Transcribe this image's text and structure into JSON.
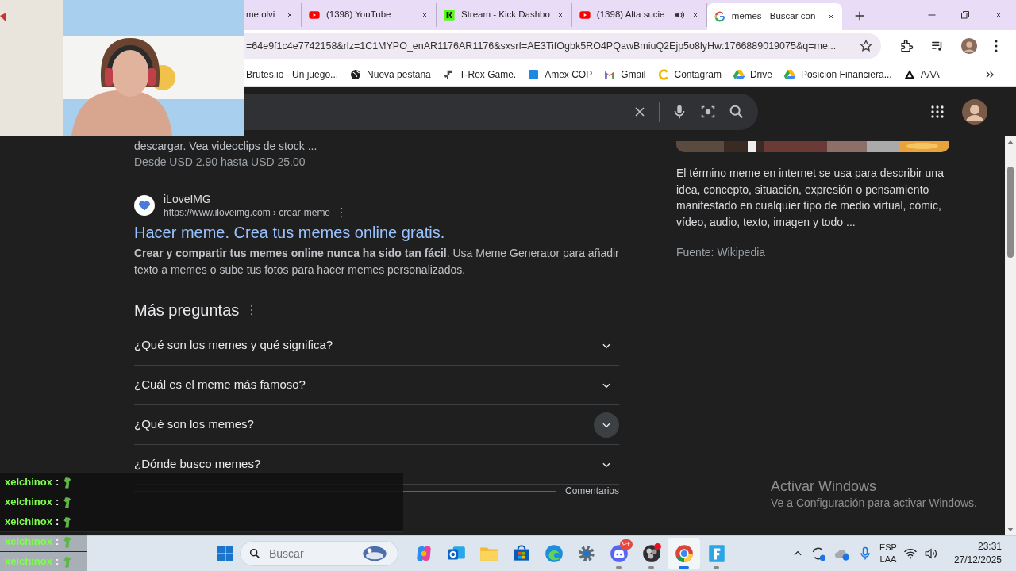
{
  "tabs": [
    {
      "title": "me olvi",
      "selected": false,
      "audio": false
    },
    {
      "title": "(1398) YouTube",
      "selected": false,
      "audio": false
    },
    {
      "title": "Stream - Kick Dashbo",
      "selected": false,
      "audio": false
    },
    {
      "title": "(1398) Alta sucie",
      "selected": false,
      "audio": true
    },
    {
      "title": "memes - Buscar con",
      "selected": true,
      "audio": false
    }
  ],
  "address_bar": {
    "url": "=64e9f1c4e7742158&rlz=1C1MYPO_enAR1176AR1176&sxsrf=AE3TifOgbk5RO4PQawBmiuQ2Ejp5o8lyHw:1766889019075&q=me..."
  },
  "bookmarks": [
    {
      "label": "Brutes.io - Un juego..."
    },
    {
      "label": "Nueva pestaña"
    },
    {
      "label": "T-Rex Game."
    },
    {
      "label": "Amex COP"
    },
    {
      "label": "Gmail"
    },
    {
      "label": "Contagram"
    },
    {
      "label": "Drive"
    },
    {
      "label": "Posicion Financiera..."
    },
    {
      "label": "AAA"
    }
  ],
  "results": {
    "snippet_tail": "descargar. Vea videoclips de stock ...",
    "price": "Desde USD 2.90 hasta USD 25.00",
    "result": {
      "site": "iLoveIMG",
      "url": "https://www.iloveimg.com › crear-meme",
      "title": "Hacer meme. Crea tus memes online gratis.",
      "snippet": "**Crear y compartir tus memes online nunca ha sido tan fácil**. Usa Meme Generator para añadir texto a memes o sube tus fotos para hacer memes personalizados."
    }
  },
  "questions": {
    "heading": "Más preguntas",
    "items": [
      {
        "text": "¿Qué son los memes y qué significa?",
        "expanded": false,
        "hovered": false
      },
      {
        "text": "¿Cuál es el meme más famoso?",
        "expanded": false,
        "hovered": false
      },
      {
        "text": "¿Qué son los memes?",
        "expanded": false,
        "hovered": true
      },
      {
        "text": "¿Dónde busco memes?",
        "expanded": false,
        "hovered": false
      }
    ],
    "feedback": "Comentarios"
  },
  "knowledge_panel": {
    "description": "El término meme en internet se usa para describir una idea, concepto, situación, expresión o pensamiento manifestado en cualquier tipo de medio virtual, cómic, vídeo, audio, texto, imagen y todo ...",
    "source_label": "Fuente:",
    "source": "Wikipedia"
  },
  "windows_notice": {
    "title": "Activar Windows",
    "text": "Ve a Configuración para activar Windows."
  },
  "chat": [
    {
      "user": "xelchinox",
      "separator": ":"
    },
    {
      "user": "xelchinox",
      "separator": ":"
    },
    {
      "user": "xelchinox",
      "separator": ":"
    },
    {
      "user": "xelchinox",
      "separator": ":"
    },
    {
      "user": "xelchinox",
      "separator": ":"
    }
  ],
  "taskbar": {
    "search_placeholder": "Buscar",
    "apps": [
      {
        "running": false,
        "active": false
      },
      {
        "running": false,
        "active": false
      },
      {
        "running": false,
        "active": false
      },
      {
        "running": false,
        "active": false
      },
      {
        "running": false,
        "active": false
      },
      {
        "running": false,
        "active": false
      },
      {
        "running": true,
        "active": false,
        "badge": "9+"
      },
      {
        "running": true,
        "active": false
      },
      {
        "running": true,
        "active": true
      },
      {
        "running": true,
        "active": false
      }
    ],
    "language": "ESP",
    "layout": "LAA",
    "time": "23:31",
    "date": "27/12/2025"
  }
}
